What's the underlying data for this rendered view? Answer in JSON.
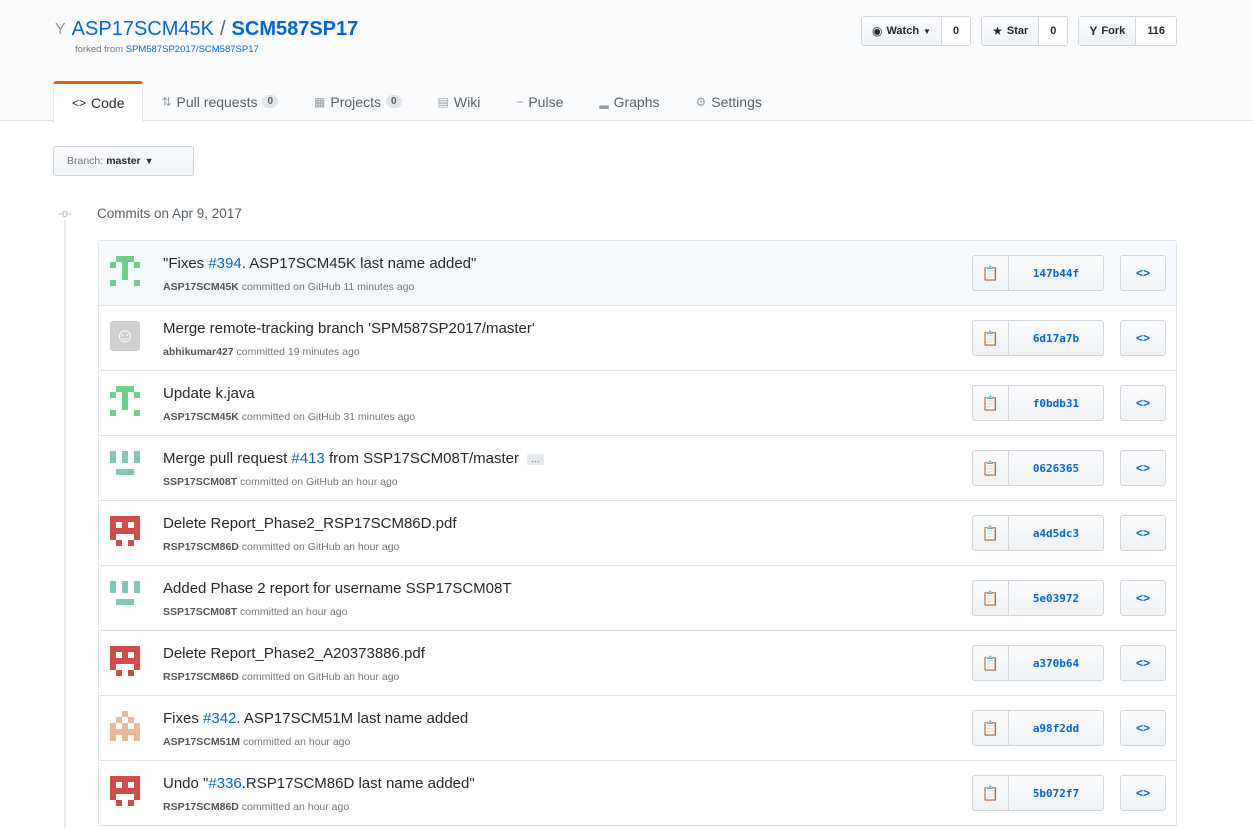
{
  "repo": {
    "owner": "ASP17SCM45K",
    "separator": "/",
    "name": "SCM587SP17",
    "forked_prefix": "forked from ",
    "forked_from": "SPM587SP2017/SCM587SP17"
  },
  "actions": {
    "watch_label": "Watch",
    "watch_count": "0",
    "star_label": "Star",
    "star_count": "0",
    "fork_label": "Fork",
    "fork_count": "116"
  },
  "nav": {
    "code": "Code",
    "pull_requests": "Pull requests",
    "pull_requests_count": "0",
    "projects": "Projects",
    "projects_count": "0",
    "wiki": "Wiki",
    "pulse": "Pulse",
    "graphs": "Graphs",
    "settings": "Settings"
  },
  "branch": {
    "label": "Branch:",
    "value": "master"
  },
  "commit_group": {
    "title": "Commits on Apr 9, 2017"
  },
  "commits": [
    {
      "title_pre": "\"Fixes ",
      "title_link": "#394",
      "title_post": ". ASP17SCM45K last name added\"",
      "author": "ASP17SCM45K",
      "meta": " committed on GitHub 11 minutes ago",
      "sha": "147b44f"
    },
    {
      "title_pre": "Merge remote-tracking branch 'SPM587SP2017/master'",
      "title_link": "",
      "title_post": "",
      "author": "abhikumar427",
      "meta": " committed 19 minutes ago",
      "sha": "6d17a7b"
    },
    {
      "title_pre": "Update k.java",
      "title_link": "",
      "title_post": "",
      "author": "ASP17SCM45K",
      "meta": " committed on GitHub 31 minutes ago",
      "sha": "f0bdb31"
    },
    {
      "title_pre": "Merge pull request ",
      "title_link": "#413",
      "title_post": " from SSP17SCM08T/master",
      "author": "SSP17SCM08T",
      "meta": " committed on GitHub an hour ago",
      "sha": "0626365"
    },
    {
      "title_pre": "Delete Report_Phase2_RSP17SCM86D.pdf",
      "title_link": "",
      "title_post": "",
      "author": "RSP17SCM86D",
      "meta": " committed on GitHub an hour ago",
      "sha": "a4d5dc3"
    },
    {
      "title_pre": "Added Phase 2 report for username SSP17SCM08T",
      "title_link": "",
      "title_post": "",
      "author": "SSP17SCM08T",
      "meta": " committed an hour ago",
      "sha": "5e03972"
    },
    {
      "title_pre": "Delete Report_Phase2_A20373886.pdf",
      "title_link": "",
      "title_post": "",
      "author": "RSP17SCM86D",
      "meta": " committed on GitHub an hour ago",
      "sha": "a370b64"
    },
    {
      "title_pre": "Fixes ",
      "title_link": "#342",
      "title_post": ". ASP17SCM51M last name added",
      "author": "ASP17SCM51M",
      "meta": " committed an hour ago",
      "sha": "a98f2dd"
    },
    {
      "title_pre": "Undo \"",
      "title_link": "#336",
      "title_post": ".RSP17SCM86D last name added\"",
      "author": "RSP17SCM86D",
      "meta": " committed an hour ago",
      "sha": "5b072f7"
    }
  ],
  "colors": {
    "link": "#0366d6",
    "avatar_green": "#6ccf8a",
    "avatar_teal": "#7fc7b9",
    "avatar_red": "#d24b4b",
    "avatar_peach": "#e8b89a",
    "nav_accent": "#e36209"
  },
  "icons": {
    "fork": "fork-icon",
    "eye": "eye-icon",
    "star": "star-icon",
    "code": "code-icon",
    "pr": "pull-request-icon",
    "project": "project-icon",
    "wiki": "book-icon",
    "pulse": "pulse-icon",
    "graph": "graph-icon",
    "gear": "gear-icon",
    "clipboard": "clippy-icon",
    "browse": "code-icon"
  }
}
